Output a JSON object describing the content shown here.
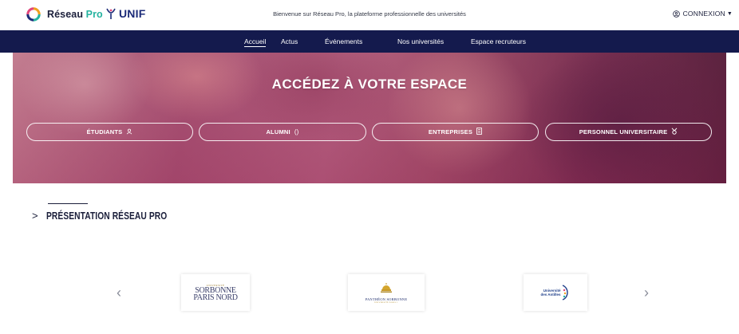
{
  "header": {
    "brand_name": "Réseau",
    "brand_suffix": "Pro",
    "partner": "UNIF",
    "welcome": "Bienvenue sur Réseau Pro, la plateforme professionnelle des universités",
    "login_label": "CONNEXION",
    "colors": {
      "brand_teal": "#26b3a0",
      "navy": "#141a4d"
    }
  },
  "nav": {
    "items": [
      "Accueil",
      "Actus",
      "Événements",
      "Nos universités",
      "Espace recruteurs"
    ],
    "active": "Accueil"
  },
  "hero": {
    "title": "ACCÉDEZ À VOTRE ESPACE",
    "buttons": [
      {
        "label": "ÉTUDIANTS",
        "icon": "user-icon"
      },
      {
        "label": "ALUMNI",
        "icon": "parentheses-icon"
      },
      {
        "label": "ENTREPRISES",
        "icon": "building-icon"
      },
      {
        "label": "PERSONNEL UNIVERSITAIRE",
        "icon": "award-icon"
      }
    ]
  },
  "presentation": {
    "heading": "PRÉSENTATION RÉSEAU PRO"
  },
  "carousel": {
    "prev": "‹",
    "next": "›",
    "logos": [
      {
        "name": "Sorbonne Paris Nord",
        "line1": "SORBONNE",
        "line2": "PARIS NORD",
        "small": "UNIVERSITÉ"
      },
      {
        "name": "Panthéon Sorbonne",
        "title": "PANTHÉON SORBONNE",
        "sub": "UNIVERSITÉ PARIS 1"
      },
      {
        "name": "Université des Antilles",
        "line1": "Université",
        "line2": "des Antilles"
      }
    ]
  }
}
